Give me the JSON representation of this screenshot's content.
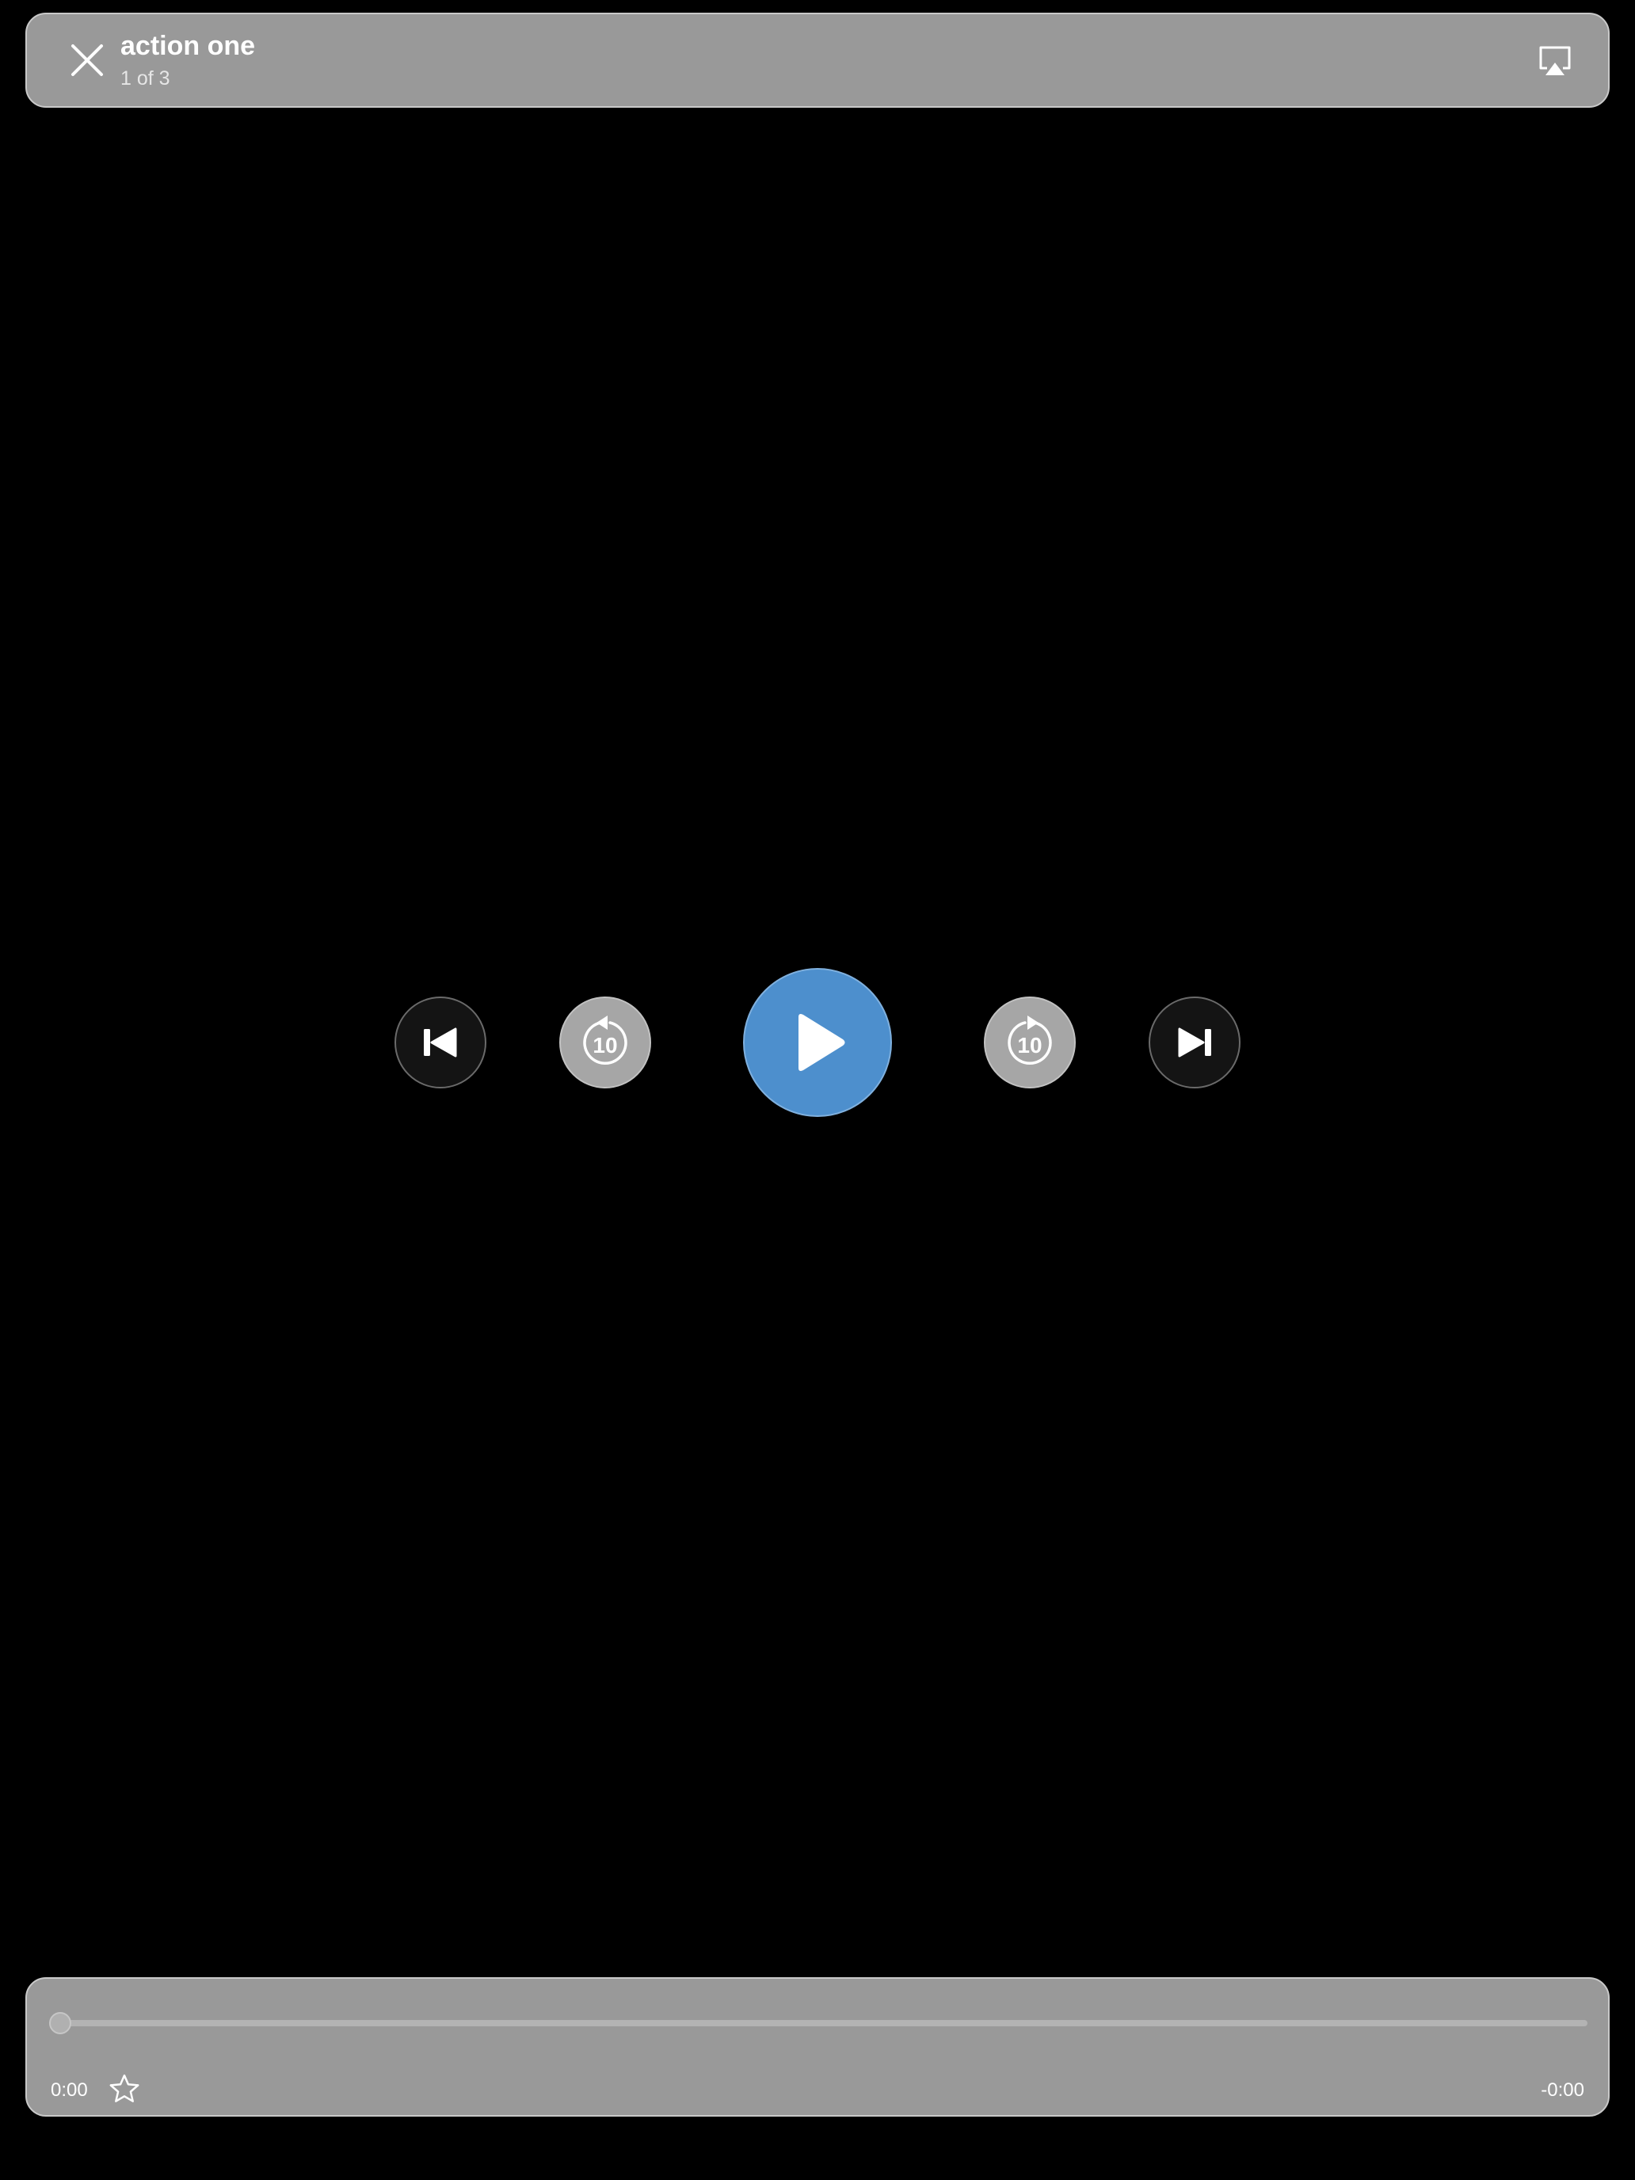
{
  "header": {
    "title": "action one",
    "counter": "1 of 3",
    "close_icon": "close-icon",
    "airplay_icon": "airplay-icon"
  },
  "controls": {
    "previous_icon": "skip-back-icon",
    "rewind_label": "10",
    "rewind_icon": "rewind-10-icon",
    "play_icon": "play-icon",
    "forward_label": "10",
    "forward_icon": "forward-10-icon",
    "next_icon": "skip-forward-icon",
    "play_color": "#4d8fcd"
  },
  "progress": {
    "elapsed": "0:00",
    "remaining": "-0:00",
    "fraction": 0,
    "favorite_icon": "star-outline-icon"
  }
}
